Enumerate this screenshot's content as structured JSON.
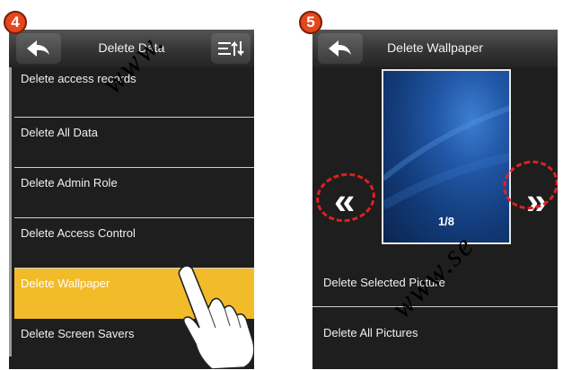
{
  "left_panel": {
    "step_number": "4",
    "title": "Delete Data",
    "items": [
      {
        "label": "Delete access records"
      },
      {
        "label": "Delete All Data"
      },
      {
        "label": "Delete Admin Role"
      },
      {
        "label": "Delete Access Control"
      },
      {
        "label": "Delete Wallpaper"
      },
      {
        "label": "Delete Screen Savers"
      }
    ],
    "selected_item": "Delete Wallpaper",
    "back_icon": "back-arrow-icon",
    "sort_icon": "sort-list-icon"
  },
  "right_panel": {
    "step_number": "5",
    "title": "Delete Wallpaper",
    "counter": "1/8",
    "prev_label": "«",
    "next_label": "»",
    "delete_selected_label": "Delete Selected Picture",
    "delete_all_label": "Delete All Pictures",
    "back_icon": "back-arrow-icon"
  },
  "watermark": {
    "text_left": "www.",
    "text_right": "www.se"
  },
  "colors": {
    "highlight": "#f2bb2a",
    "badge": "#e4471d",
    "screen_bg": "#1e1e1e",
    "annotation_circle": "#e02020"
  }
}
